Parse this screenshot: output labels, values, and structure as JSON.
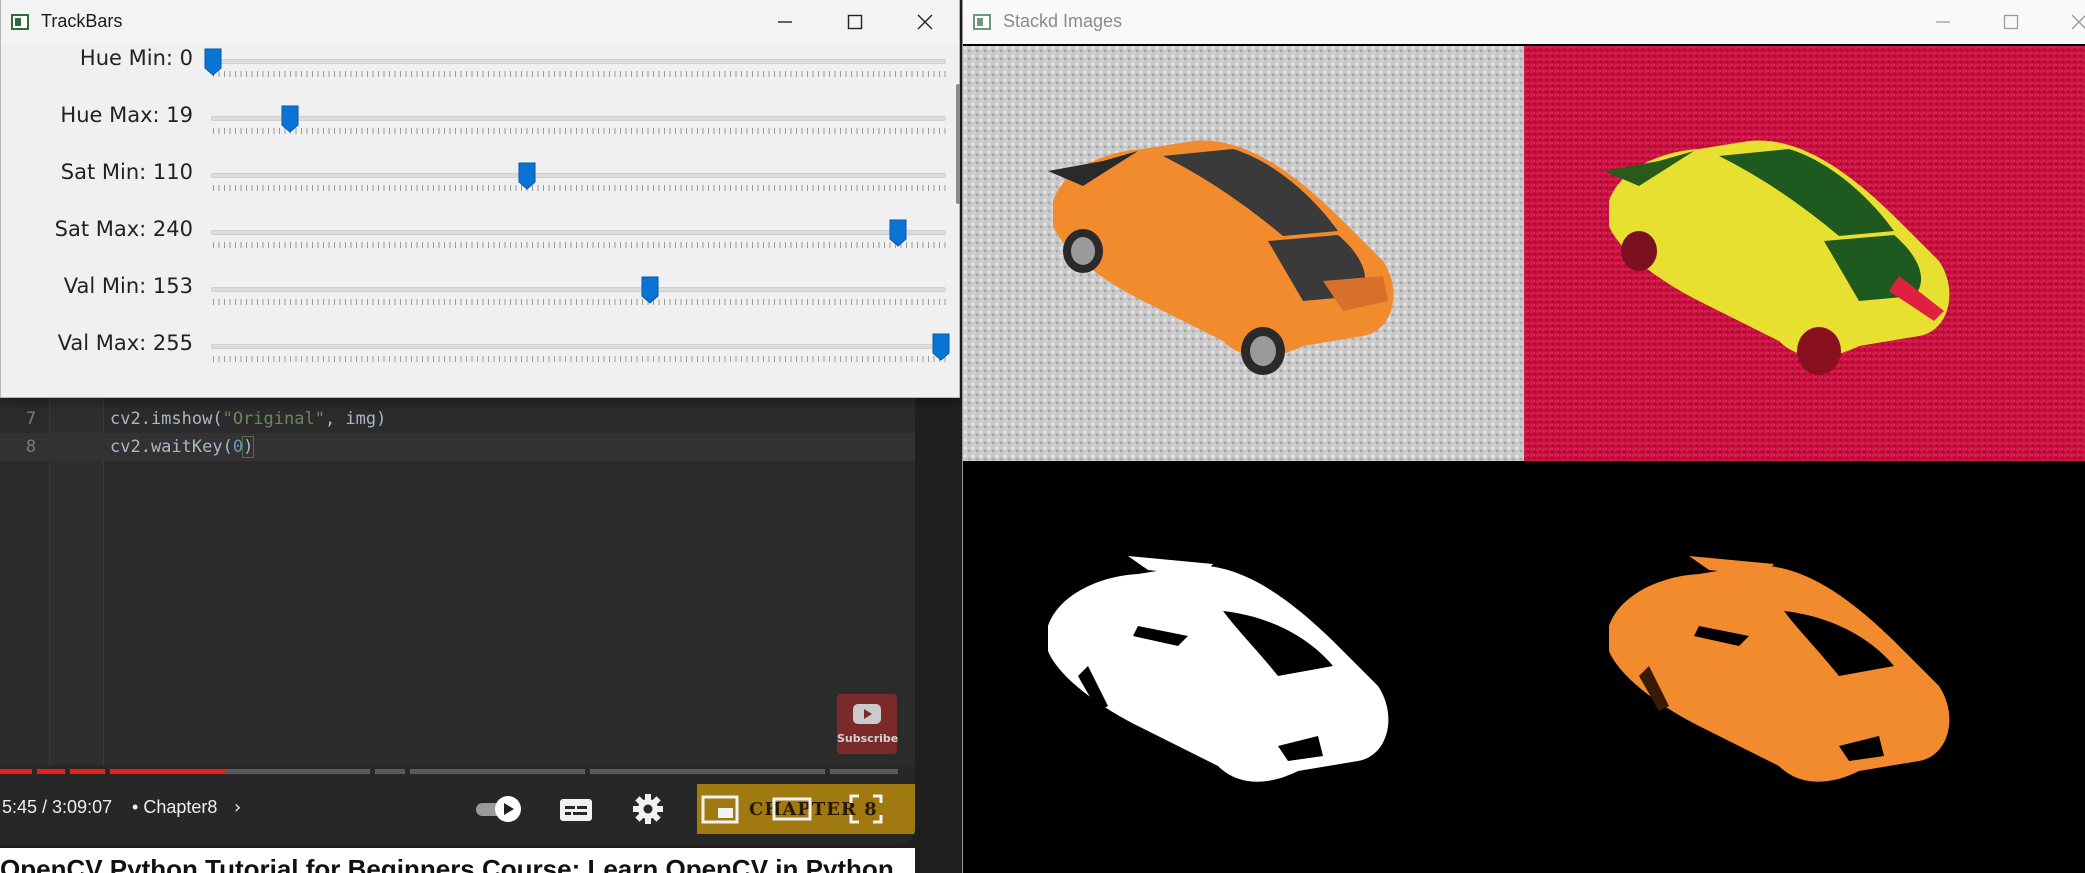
{
  "youtube": {
    "editor": {
      "lines": [
        {
          "number": "7",
          "before": "cv2.imshow(",
          "string": "\"Original\"",
          "after": ", img)"
        },
        {
          "number": "8",
          "before": "cv2.waitKey(",
          "number_arg": "0",
          "after": ")"
        }
      ]
    },
    "subscribe_label": "Subscribe",
    "progress_fraction": 0.19,
    "time": "5:45 / 3:09:07",
    "chapter_separator": "•",
    "chapter": "Chapter8",
    "chapter_chevron": "›",
    "chapter_thumb_text": "CHAPTER 8",
    "below_title": "OpenCV Python Tutorial for Beginners Course: Learn OpenCV in Python",
    "icons": [
      "autoplay-toggle-icon",
      "subtitles-icon",
      "settings-gear-icon",
      "miniplayer-icon",
      "theater-mode-icon",
      "fullscreen-icon",
      "youtube-logo-icon"
    ]
  },
  "trackbars": {
    "window_title": "TrackBars",
    "sliders": [
      {
        "label": "Hue Min: 0",
        "value": 0,
        "max": 179
      },
      {
        "label": "Hue Max: 19",
        "value": 19,
        "max": 179
      },
      {
        "label": "Sat Min: 110",
        "value": 110,
        "max": 255
      },
      {
        "label": "Sat Max: 240",
        "value": 240,
        "max": 255
      },
      {
        "label": "Val Min: 153",
        "value": 153,
        "max": 255
      },
      {
        "label": "Val Max: 255",
        "value": 255,
        "max": 255
      }
    ],
    "accent_color": "#0a74d6",
    "icons": [
      "minimize-icon",
      "maximize-icon",
      "close-icon"
    ]
  },
  "stacked": {
    "window_title": "Stackd Images",
    "colors": {
      "car_orange": "#f28a2e",
      "hsv_background": "#c8103a",
      "hsv_car": "#e8e030",
      "carpet": "#c8c8c8"
    },
    "images": [
      "original-image",
      "hsv-image",
      "mask-image",
      "result-image"
    ]
  }
}
